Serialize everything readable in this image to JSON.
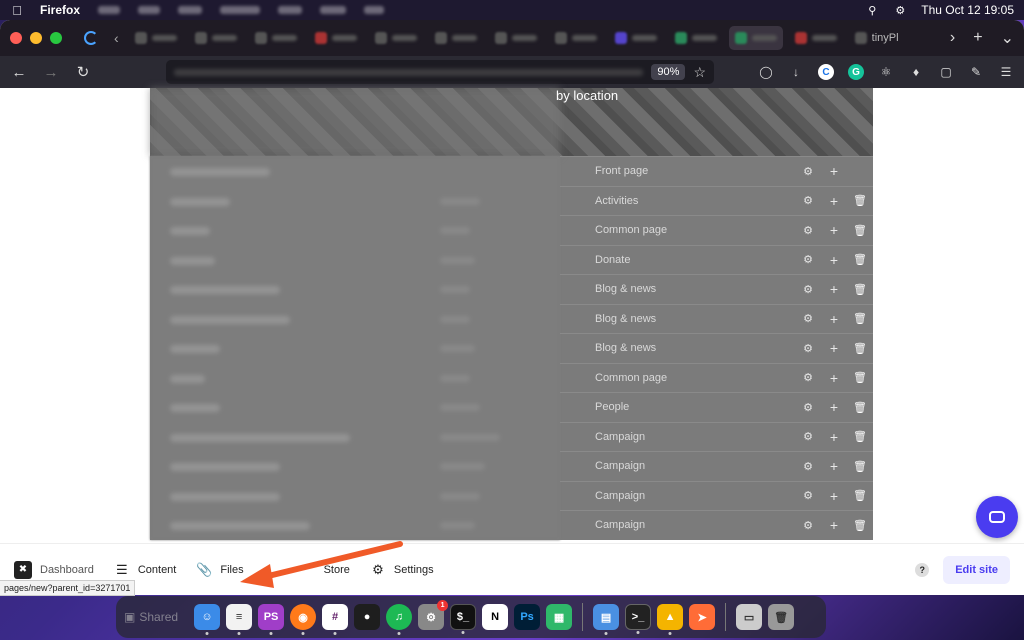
{
  "menubar": {
    "app_name": "Firefox",
    "datetime": "Thu Oct 12  19:05"
  },
  "browser": {
    "tab_named_label": "tinyPl",
    "zoom": "90%"
  },
  "hero": {
    "text": "by location"
  },
  "rows": [
    {
      "type": "Front page",
      "trash": false
    },
    {
      "type": "Activities",
      "trash": true
    },
    {
      "type": "Common page",
      "trash": true
    },
    {
      "type": "Donate",
      "trash": true
    },
    {
      "type": "Blog & news",
      "trash": true
    },
    {
      "type": "Blog & news",
      "trash": true
    },
    {
      "type": "Blog & news",
      "trash": true
    },
    {
      "type": "Common page",
      "trash": true
    },
    {
      "type": "People",
      "trash": true
    },
    {
      "type": "Campaign",
      "trash": true
    },
    {
      "type": "Campaign",
      "trash": true
    },
    {
      "type": "Campaign",
      "trash": true
    },
    {
      "type": "Campaign",
      "trash": true
    }
  ],
  "toolbar": {
    "dashboard": "Dashboard",
    "content": "Content",
    "files": "Files",
    "store": "Store",
    "settings": "Settings",
    "help": "?",
    "edit_site": "Edit site"
  },
  "status_url": "pages/new?parent_id=3271701",
  "dock": {
    "shared": "Shared"
  },
  "colors": {
    "accent": "#4a3cf0",
    "arrow": "#f05a28"
  }
}
